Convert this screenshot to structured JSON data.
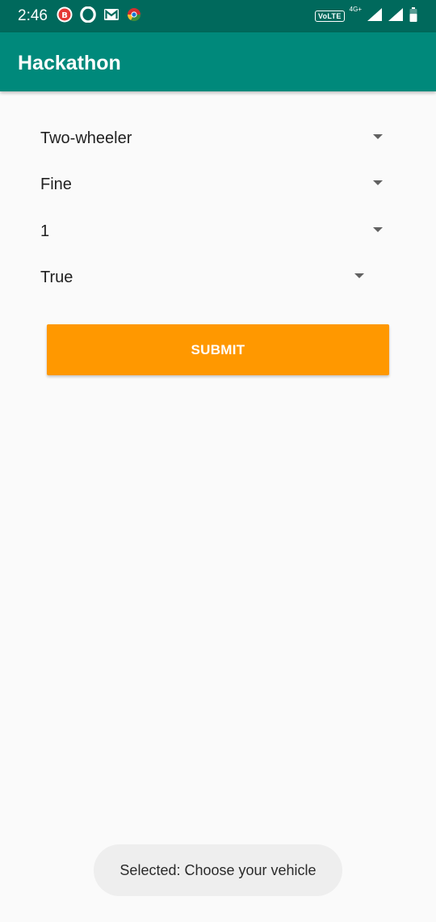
{
  "status_bar": {
    "time": "2:46",
    "volte_label": "VoLTE",
    "network_type": "4G+",
    "colors": {
      "background": "#00695c"
    }
  },
  "app_bar": {
    "title": "Hackathon",
    "colors": {
      "background": "#00897b"
    }
  },
  "form": {
    "spinners": [
      {
        "selected": "Two-wheeler"
      },
      {
        "selected": "Fine"
      },
      {
        "selected": "1"
      },
      {
        "selected": "True"
      }
    ],
    "submit_label": "SUBMIT",
    "submit_color": "#ff9800"
  },
  "toast": {
    "message": "Selected: Choose your vehicle"
  },
  "icons": {
    "status_left": [
      "notification-badge-icon",
      "opera-icon",
      "gmail-icon",
      "chrome-icon"
    ],
    "status_right": [
      "volte-icon",
      "signal-icon",
      "signal-icon",
      "battery-icon"
    ],
    "spinner": "dropdown-arrow-icon"
  }
}
